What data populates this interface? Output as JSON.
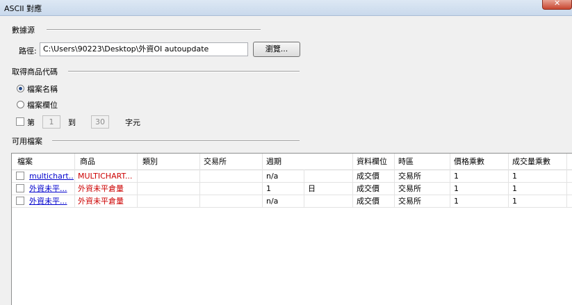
{
  "window": {
    "title": "ASCII 對應"
  },
  "datasource": {
    "section_label": "數據源",
    "path_label": "路徑:",
    "path_value": "C:\\Users\\90223\\Desktop\\外資OI autoupdate",
    "browse_label": "瀏覽..."
  },
  "symbol": {
    "section_label": "取得商品代碼",
    "option_filename": "檔案名稱",
    "option_field": "檔案欄位",
    "selected": "檔案名稱",
    "range_prefix": "第",
    "range_from": "1",
    "range_to_label": "到",
    "range_to": "30",
    "range_suffix": "字元"
  },
  "files": {
    "section_label": "可用檔案",
    "columns": [
      "檔案",
      "商品",
      "類別",
      "交易所",
      "週期",
      "",
      "資料欄位",
      "時區",
      "價格乘數",
      "成交量乘數"
    ],
    "rows": [
      [
        "multichart...",
        "MULTICHART...",
        "",
        "",
        "n/a",
        "",
        "成交價",
        "交易所",
        "1",
        "1"
      ],
      [
        "外資未平...",
        "外資未平倉量",
        "",
        "",
        "1",
        "日",
        "成交價",
        "交易所",
        "1",
        "1"
      ],
      [
        "外資未平...",
        "外資未平倉量",
        "",
        "",
        "n/a",
        "",
        "成交價",
        "交易所",
        "1",
        "1"
      ]
    ]
  },
  "colors": {
    "link": "#0000cc",
    "symbol_text": "#cc0000"
  }
}
